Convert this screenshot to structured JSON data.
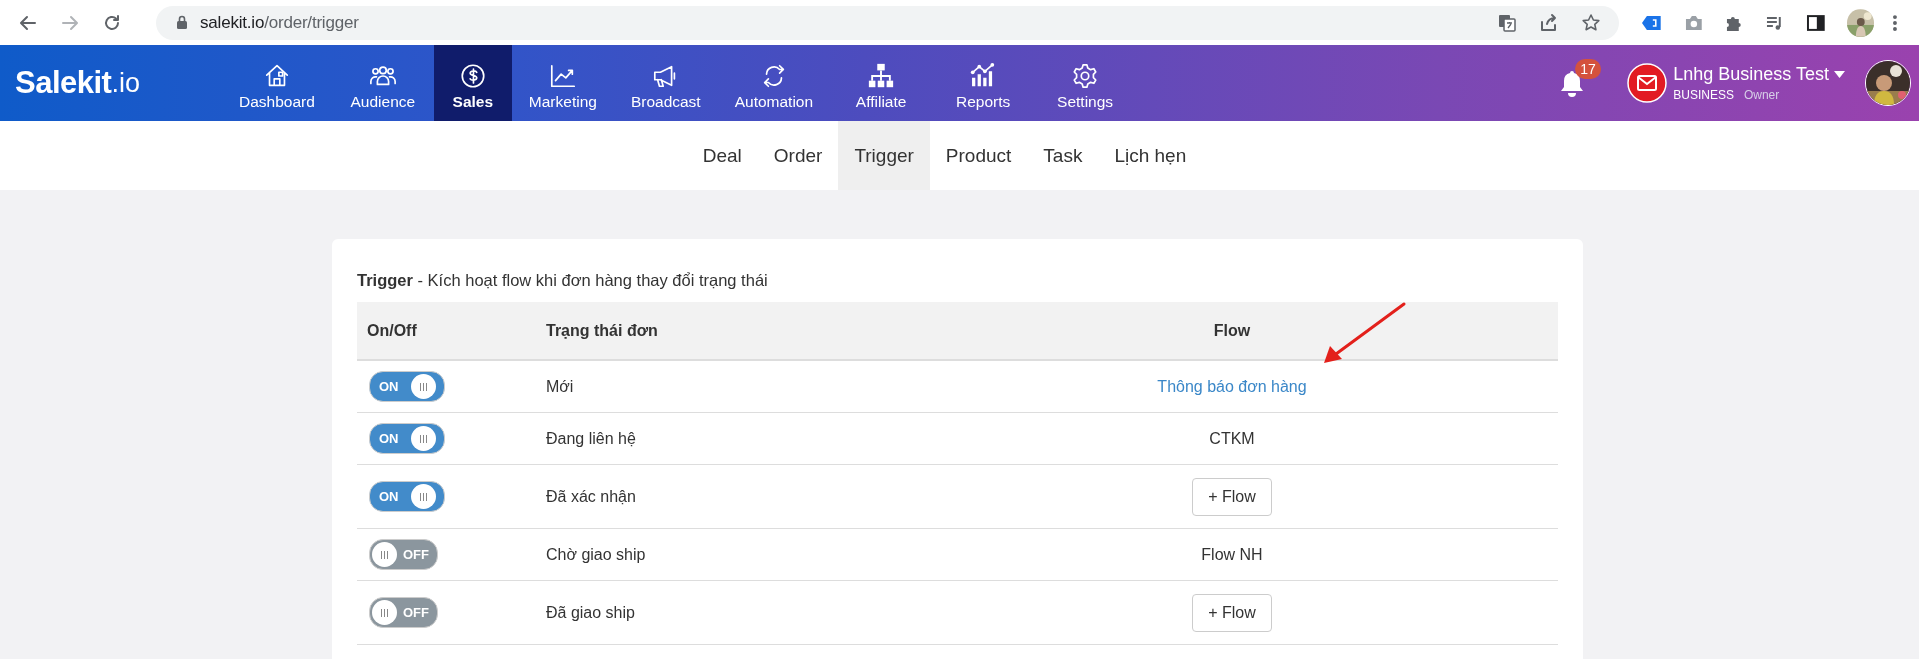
{
  "browser": {
    "url_host": "salekit.io",
    "url_path": "/order/trigger"
  },
  "app": {
    "logo_main": "Salekit",
    "logo_suffix": ".io",
    "nav": [
      {
        "label": "Dashboard",
        "selected": false
      },
      {
        "label": "Audience",
        "selected": false
      },
      {
        "label": "Sales",
        "selected": true
      },
      {
        "label": "Marketing",
        "selected": false
      },
      {
        "label": "Broadcast",
        "selected": false
      },
      {
        "label": "Automation",
        "selected": false
      },
      {
        "label": "Affiliate",
        "selected": false
      },
      {
        "label": "Reports",
        "selected": false
      },
      {
        "label": "Settings",
        "selected": false
      }
    ],
    "notifications": {
      "count": "17"
    },
    "account": {
      "name": "Lnhg Business Test",
      "plan": "BUSINESS",
      "role": "Owner"
    }
  },
  "subtabs": [
    {
      "label": "Deal",
      "selected": false
    },
    {
      "label": "Order",
      "selected": false
    },
    {
      "label": "Trigger",
      "selected": true
    },
    {
      "label": "Product",
      "selected": false
    },
    {
      "label": "Task",
      "selected": false
    },
    {
      "label": "Lịch hẹn",
      "selected": false
    }
  ],
  "card": {
    "title": "**Trigger** - Kích hoạt flow khi đơn hàng thay đổi trạng thái"
  },
  "table": {
    "columns": [
      "On/Off",
      "Trạng thái đơn",
      "Flow"
    ],
    "rows": [
      {
        "on": true,
        "toggle_label": "ON",
        "status": "Mới",
        "flow": {
          "kind": "link",
          "text": "Thông báo đơn hàng"
        }
      },
      {
        "on": true,
        "toggle_label": "ON",
        "status": "Đang liên hệ",
        "flow": {
          "kind": "text",
          "text": "CTKM"
        }
      },
      {
        "on": true,
        "toggle_label": "ON",
        "status": "Đã xác nhận",
        "flow": {
          "kind": "button",
          "text": "+ Flow"
        }
      },
      {
        "on": false,
        "toggle_label": "OFF",
        "status": "Chờ giao ship",
        "flow": {
          "kind": "text",
          "text": "Flow NH"
        }
      },
      {
        "on": false,
        "toggle_label": "OFF",
        "status": "Đã giao ship",
        "flow": {
          "kind": "button",
          "text": "+ Flow"
        }
      }
    ]
  }
}
